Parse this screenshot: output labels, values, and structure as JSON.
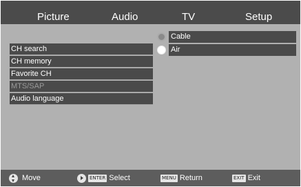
{
  "tabs": {
    "picture": "Picture",
    "audio": "Audio",
    "tv": "TV",
    "setup": "Setup"
  },
  "menu": {
    "items": [
      {
        "label": "CH search",
        "enabled": true
      },
      {
        "label": "CH memory",
        "enabled": true
      },
      {
        "label": "Favorite CH",
        "enabled": true
      },
      {
        "label": "MTS/SAP",
        "enabled": false
      },
      {
        "label": "Audio language",
        "enabled": true
      }
    ]
  },
  "options": {
    "items": [
      {
        "label": "Cable",
        "selected": false
      },
      {
        "label": "Air",
        "selected": true
      }
    ]
  },
  "footer": {
    "move_label": "Move",
    "enter_key": "ENTER",
    "select_label": "Select",
    "menu_key": "MENU",
    "return_label": "Return",
    "exit_key": "EXIT",
    "exit_label": "Exit"
  },
  "colors": {
    "tab_bar": "#4b4b4b",
    "panel": "#b1b1b1",
    "item_bg": "#4a4a4a",
    "disabled_text": "#9a9a9a"
  }
}
